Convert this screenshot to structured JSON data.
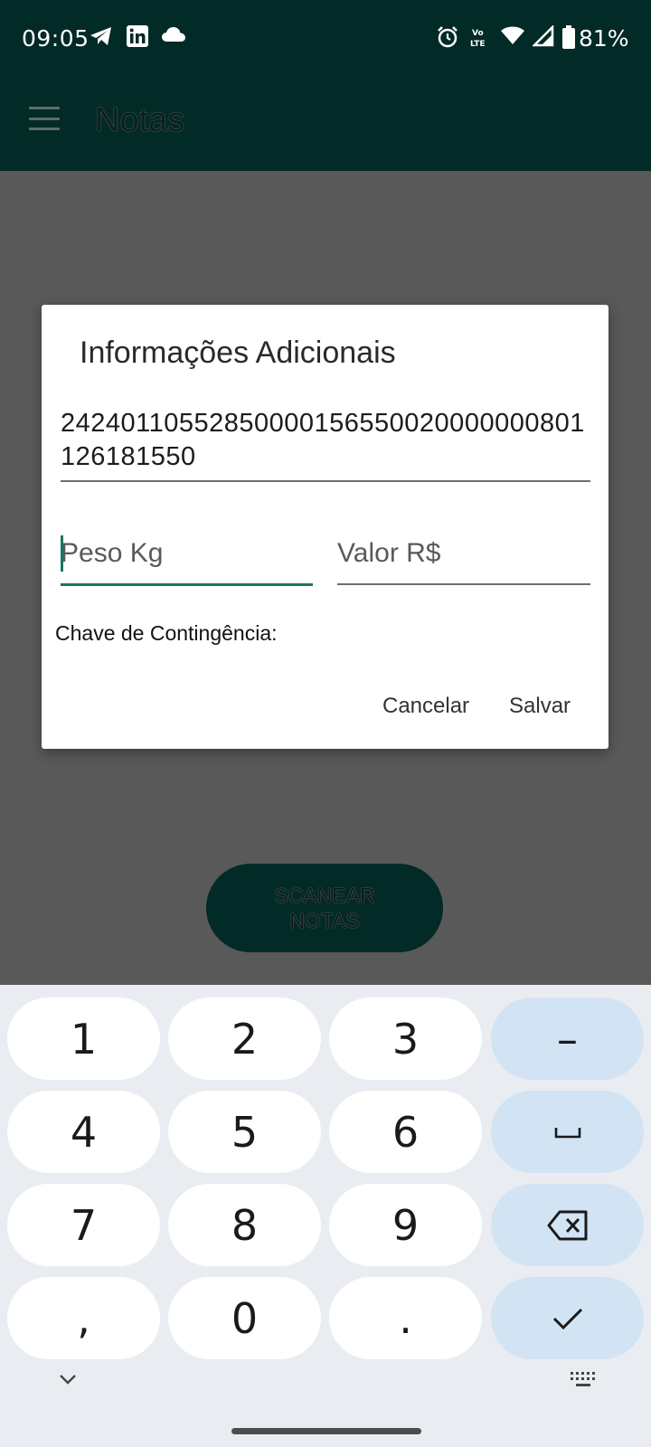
{
  "status_bar": {
    "time": "09:05",
    "battery_percent": "81%",
    "icons": [
      "telegram-icon",
      "linkedin-icon",
      "cloud-icon",
      "alarm-icon",
      "volte-icon",
      "wifi-icon",
      "signal-icon",
      "battery-icon"
    ]
  },
  "app_bar": {
    "title": "Notas",
    "menu_icon": "hamburger-menu-icon"
  },
  "background": {
    "scan_button_label": "SCANEAR\nNOTAS"
  },
  "dialog": {
    "title": "Informações Adicionais",
    "access_key": "24240110552850000156550020000000801126181550",
    "peso_placeholder": "Peso Kg",
    "valor_placeholder": "Valor R$",
    "chave_label": "Chave de Contingência:",
    "cancel_label": "Cancelar",
    "save_label": "Salvar"
  },
  "keyboard": {
    "rows": [
      [
        "1",
        "2",
        "3",
        "–"
      ],
      [
        "4",
        "5",
        "6",
        "space-icon"
      ],
      [
        "7",
        "8",
        "9",
        "backspace-icon"
      ],
      [
        ",",
        "0",
        ".",
        "checkmark-icon"
      ]
    ],
    "key_1": "1",
    "key_2": "2",
    "key_3": "3",
    "key_dash": "–",
    "key_4": "4",
    "key_5": "5",
    "key_6": "6",
    "key_7": "7",
    "key_8": "8",
    "key_9": "9",
    "key_comma": ",",
    "key_0": "0",
    "key_dot": "."
  },
  "colors": {
    "app_bar": "#022a26",
    "scrim": "#595959",
    "accent": "#1e7363",
    "keyboard_bg": "#e9ecf1",
    "key_fn": "#d2e3f4"
  }
}
